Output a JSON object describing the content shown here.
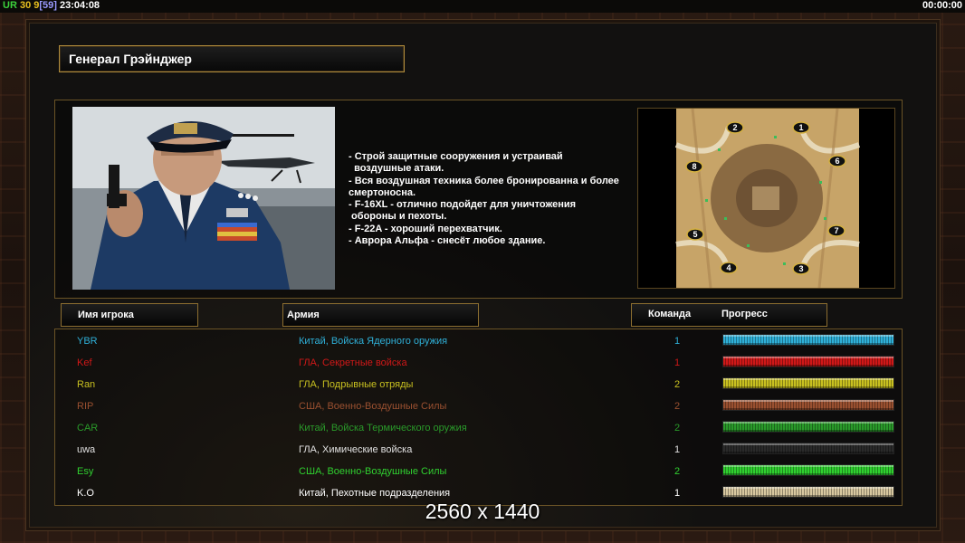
{
  "topbar": {
    "ur": "UR",
    "num1": "30",
    "num2": "9",
    "bracket": "[59]",
    "clock": "23:04:08",
    "timer": "00:00:00"
  },
  "general": {
    "title": "Генерал Грэйнджер",
    "description_lines": [
      "- Строй защитные сооружения и устраивай",
      "  воздушные атаки.",
      "- Вся воздушная техника более бронированна и более",
      "смертоносна.",
      "- F-16XL - отлично подойдет для уничтожения",
      " обороны и пехоты.",
      "- F-22A - хороший перехватчик.",
      "- Аврора Альфа - снесёт любое здание."
    ]
  },
  "map": {
    "start_positions": [
      "1",
      "2",
      "3",
      "4",
      "5",
      "6",
      "7",
      "8"
    ]
  },
  "table": {
    "headers": {
      "player": "Имя игрока",
      "army": "Армия",
      "team": "Команда",
      "progress": "Прогресс"
    },
    "rows": [
      {
        "name": "YBR",
        "army": "Китай, Войска Ядерного оружия",
        "team": "1",
        "progress": 1.0,
        "color": "#2fb0d8"
      },
      {
        "name": "Kef",
        "army": "ГЛА, Секретные войска",
        "team": "1",
        "progress": 1.0,
        "color": "#d01818"
      },
      {
        "name": "Ran",
        "army": "ГЛА, Подрывные отряды",
        "team": "2",
        "progress": 1.0,
        "color": "#c8c020"
      },
      {
        "name": "RIP",
        "army": "США, Военно-Воздушные Силы",
        "team": "2",
        "progress": 1.0,
        "color": "#9a5030"
      },
      {
        "name": "CAR",
        "army": "Китай, Войска Термического оружия",
        "team": "2",
        "progress": 1.0,
        "color": "#2a9a2a"
      },
      {
        "name": "uwa",
        "army": "ГЛА, Химические войска",
        "team": "1",
        "progress": 1.0,
        "color": "#2a2a2a"
      },
      {
        "name": "Esy",
        "army": "США, Военно-Воздушные Силы",
        "team": "2",
        "progress": 1.0,
        "color": "#30d030"
      },
      {
        "name": "K.O",
        "army": "Китай, Пехотные подразделения",
        "team": "1",
        "progress": 1.0,
        "color": "#d8c8a0"
      }
    ]
  },
  "overlay_resolution": "2560 x 1440"
}
